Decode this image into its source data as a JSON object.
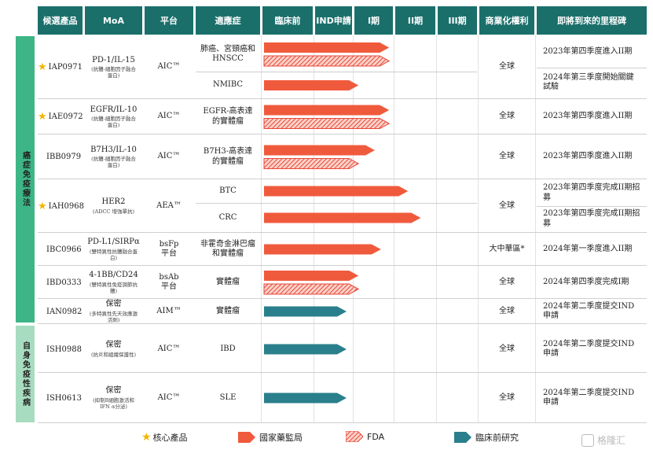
{
  "headers": [
    "候選產品",
    "MoA",
    "平台",
    "適應症",
    "臨床前",
    "IND申請",
    "I期",
    "II期",
    "III期",
    "商業化權利",
    "即將到來的里程碑"
  ],
  "sections": [
    "癌症免疫療法",
    "自身免疫性疾病"
  ],
  "rows": [
    {
      "candidate": "IAP0971",
      "core": true,
      "moa": "PD-1/IL-15",
      "moa_sub": "(抗體-細胞因子融合蛋白)",
      "platform": "AIC™",
      "indications": [
        {
          "name": "肺癌、宮頸癌和HNSCC",
          "stages": [
            {
              "type": "nmpa",
              "progress": 2.85
            },
            {
              "type": "fda",
              "progress": 2.85
            }
          ]
        },
        {
          "name": "NMIBC",
          "stages": [
            {
              "type": "nmpa",
              "progress": 2.1
            }
          ]
        }
      ],
      "rights": "全球",
      "milestones": [
        "2023年第四季度進入II期",
        "2024年第三季度開始關鍵試驗"
      ]
    },
    {
      "candidate": "IAE0972",
      "core": true,
      "moa": "EGFR/IL-10",
      "moa_sub": "(抗體-細胞因子融合蛋白)",
      "platform": "AIC™",
      "indications": [
        {
          "name": "EGFR-高表達的實體瘤",
          "stages": [
            {
              "type": "nmpa",
              "progress": 2.85
            },
            {
              "type": "fda",
              "progress": 2.85
            }
          ]
        }
      ],
      "rights": "全球",
      "milestones": [
        "2023年第四季度進入II期"
      ]
    },
    {
      "candidate": "IBB0979",
      "core": false,
      "moa": "B7H3/IL-10",
      "moa_sub": "(抗體-細胞因子融合蛋白)",
      "platform": "AIC™",
      "indications": [
        {
          "name": "B7H3-高表達的實體瘤",
          "stages": [
            {
              "type": "nmpa",
              "progress": 2.5
            },
            {
              "type": "fda",
              "progress": 2.1
            }
          ]
        }
      ],
      "rights": "全球",
      "milestones": [
        "2023年第四季度進入II期"
      ]
    },
    {
      "candidate": "IAH0968",
      "core": true,
      "moa": "HER2",
      "moa_sub": "(ADCC 增強單抗)",
      "platform": "AEA™",
      "indications": [
        {
          "name": "BTC",
          "stages": [
            {
              "type": "nmpa",
              "progress": 3.3
            }
          ]
        },
        {
          "name": "CRC",
          "stages": [
            {
              "type": "nmpa",
              "progress": 3.6
            }
          ]
        }
      ],
      "rights": "全球",
      "milestones": [
        "2023年第四季度完成II期招募",
        "2023年第四季度完成II期招募"
      ]
    },
    {
      "candidate": "IBC0966",
      "core": false,
      "moa": "PD-L1/SIRPα",
      "moa_sub": "(雙特異性抗體融合蛋白)",
      "platform": "bsFp 平台",
      "indications": [
        {
          "name": "非霍奇金淋巴瘤和實體瘤",
          "stages": [
            {
              "type": "nmpa",
              "progress": 2.65
            }
          ]
        }
      ],
      "rights": "大中華區*",
      "milestones": [
        "2024年第一季度進入II期"
      ]
    },
    {
      "candidate": "IBD0333",
      "core": false,
      "moa": "4-1BB/CD24",
      "moa_sub": "(雙特異性免疫調節抗體)",
      "platform": "bsAb 平台",
      "indications": [
        {
          "name": "實體瘤",
          "stages": [
            {
              "type": "nmpa",
              "progress": 2.1
            },
            {
              "type": "fda",
              "progress": 2.1
            }
          ]
        }
      ],
      "rights": "全球",
      "milestones": [
        "2024年第四季度完成I期"
      ]
    },
    {
      "candidate": "IAN0982",
      "core": false,
      "moa": "保密",
      "moa_sub": "(多特異性先天效應激活劑)",
      "platform": "AIM™",
      "indications": [
        {
          "name": "實體瘤",
          "stages": [
            {
              "type": "preclinical",
              "progress": 1.8
            }
          ]
        }
      ],
      "rights": "全球",
      "milestones": [
        "2024年第二季度提交IND申請"
      ]
    },
    {
      "candidate": "ISH0988",
      "core": false,
      "moa": "保密",
      "moa_sub": "(抗炎和組織保護性)",
      "platform": "AIC™",
      "indications": [
        {
          "name": "IBD",
          "stages": [
            {
              "type": "preclinical",
              "progress": 1.8
            }
          ]
        }
      ],
      "rights": "全球",
      "milestones": [
        "2024年第二季度提交IND申請"
      ]
    },
    {
      "candidate": "ISH0613",
      "core": false,
      "moa": "保密",
      "moa_sub": "(抑制B細胞激活和IFN α分泌)",
      "platform": "AIC™",
      "indications": [
        {
          "name": "SLE",
          "stages": [
            {
              "type": "preclinical",
              "progress": 1.8
            }
          ]
        }
      ],
      "rights": "全球",
      "milestones": [
        "2024年第二季度提交IND申請"
      ]
    }
  ],
  "legend": {
    "core": "核心產品",
    "nmpa": "國家藥監局",
    "fda": "FDA",
    "preclinical": "臨床前研究"
  },
  "colors": {
    "header": "#1a6f6b",
    "nmpa": "#f05a3c",
    "fda": "#f05a3c",
    "preclinical": "#2a7f8c",
    "side1": "#3db586",
    "side2": "#a8dcc0",
    "star": "#f3b400"
  },
  "watermark": "格隆汇"
}
